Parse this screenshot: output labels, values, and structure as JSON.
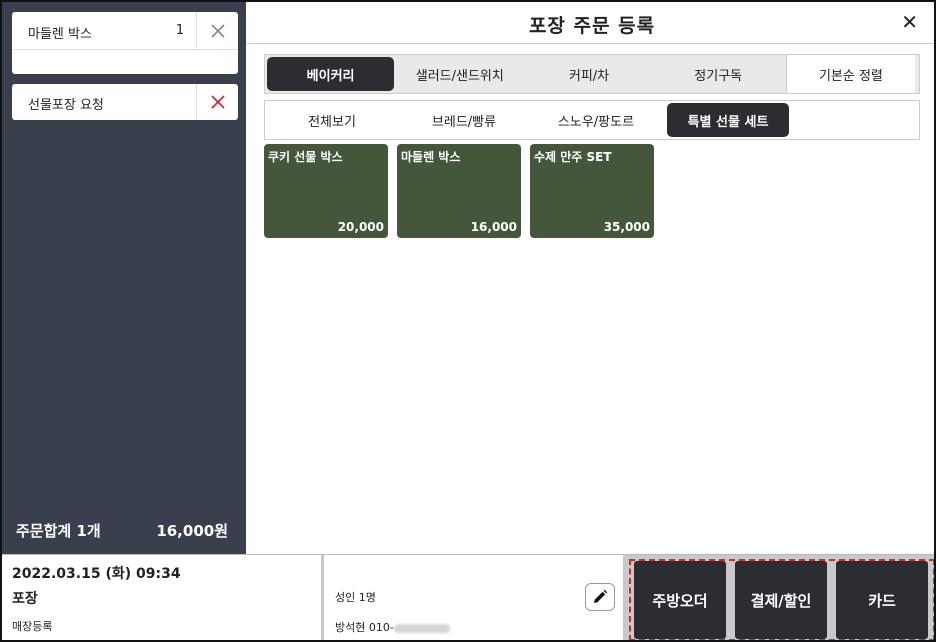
{
  "order": {
    "items": [
      {
        "name": "마들렌 박스",
        "qty": "1"
      }
    ],
    "gift_request": "선물포장 요청",
    "total_label": "주문합계 1개",
    "total_amount": "16,000원"
  },
  "header": {
    "title": "포장 주문 등록",
    "close_label": "✕"
  },
  "categories": [
    "베이커리",
    "샐러드/샌드위치",
    "커피/차",
    "정기구독"
  ],
  "sort_label": "기본순 정렬",
  "subcategories": [
    "전체보기",
    "브레드/빵류",
    "스노우/팡도르",
    "특별 선물 세트"
  ],
  "products": [
    {
      "name": "쿠키 선물 박스",
      "price": "20,000"
    },
    {
      "name": "마들렌 박스",
      "price": "16,000"
    },
    {
      "name": "수제 만주 SET",
      "price": "35,000"
    }
  ],
  "footer": {
    "datetime": "2022.03.15 (화) 09:34",
    "order_type": "포장",
    "store_register": "매장등록",
    "guests": "성인 1명",
    "customer": "방석현 010-"
  },
  "actions": [
    "주방오더",
    "결제/할인",
    "카드"
  ],
  "colors": {
    "sidebar": "#3a3f4d",
    "product_tile": "#44573a",
    "active_tab": "#2b2d33",
    "highlight_dash": "#d62a2a"
  }
}
